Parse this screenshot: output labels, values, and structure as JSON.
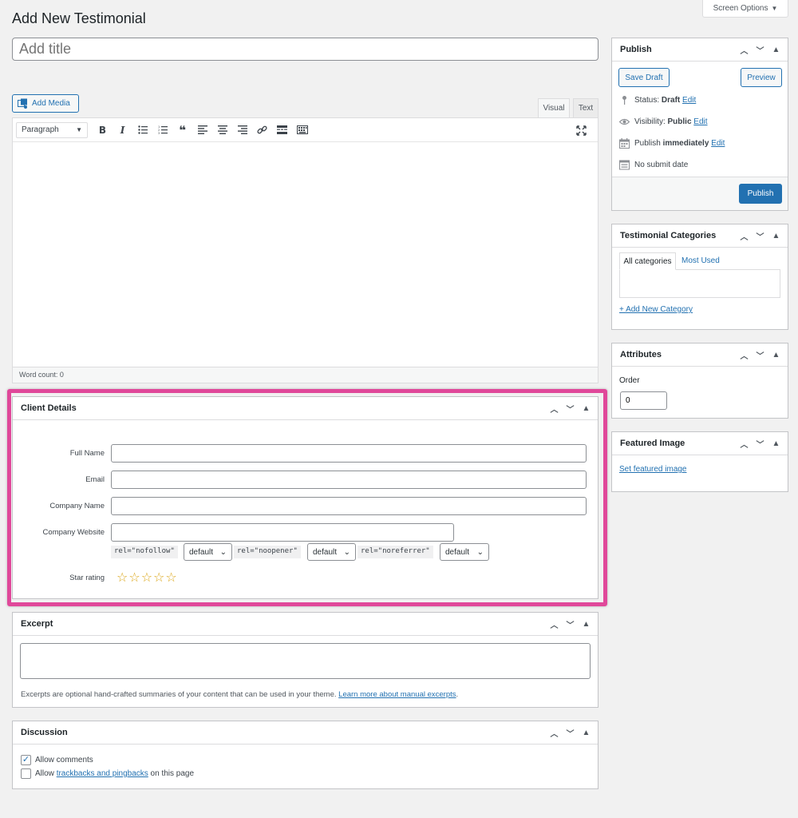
{
  "header": {
    "title": "Add New Testimonial",
    "screen_options": "Screen Options"
  },
  "post_title": {
    "placeholder": "Add title"
  },
  "editor": {
    "add_media_label": "Add Media",
    "tab_visual": "Visual",
    "tab_text": "Text",
    "format_select": "Paragraph",
    "word_count": "Word count: 0"
  },
  "client_details": {
    "heading": "Client Details",
    "full_name_label": "Full Name",
    "email_label": "Email",
    "company_name_label": "Company Name",
    "company_website_label": "Company Website",
    "rel_nofollow": "rel=\"nofollow\"",
    "rel_noopener": "rel=\"noopener\"",
    "rel_noreferrer": "rel=\"noreferrer\"",
    "nofollow_value": "default",
    "noopener_value": "default",
    "noreferrer_value": "default",
    "star_rating_label": "Star rating",
    "star_rating_value": 0,
    "star_rating_max": 5
  },
  "excerpt": {
    "heading": "Excerpt",
    "help_text": "Excerpts are optional hand-crafted summaries of your content that can be used in your theme.",
    "help_link": "Learn more about manual excerpts",
    "help_tail": "."
  },
  "discussion": {
    "heading": "Discussion",
    "allow_comments": "Allow comments",
    "allow_comments_checked": true,
    "allow_prefix": "Allow",
    "trackbacks_link": "trackbacks and pingbacks",
    "trackbacks_suffix": "on this page",
    "trackbacks_checked": false
  },
  "publish": {
    "heading": "Publish",
    "save_draft": "Save Draft",
    "preview": "Preview",
    "status_label": "Status:",
    "status_value": "Draft",
    "visibility_label": "Visibility:",
    "visibility_value": "Public",
    "publish_label": "Publish",
    "publish_value": "immediately",
    "edit_link": "Edit",
    "no_submit_date": "No submit date",
    "publish_button": "Publish"
  },
  "categories": {
    "heading": "Testimonial Categories",
    "tab_all": "All categories",
    "tab_most_used": "Most Used",
    "add_new": "+ Add New Category"
  },
  "attributes": {
    "heading": "Attributes",
    "order_label": "Order",
    "order_value": "0"
  },
  "featured_image": {
    "heading": "Featured Image",
    "set_link": "Set featured image"
  },
  "colors": {
    "accent": "#2271b1",
    "highlight": "#e0489a",
    "star": "#dba617",
    "background": "#f1f1f1"
  }
}
